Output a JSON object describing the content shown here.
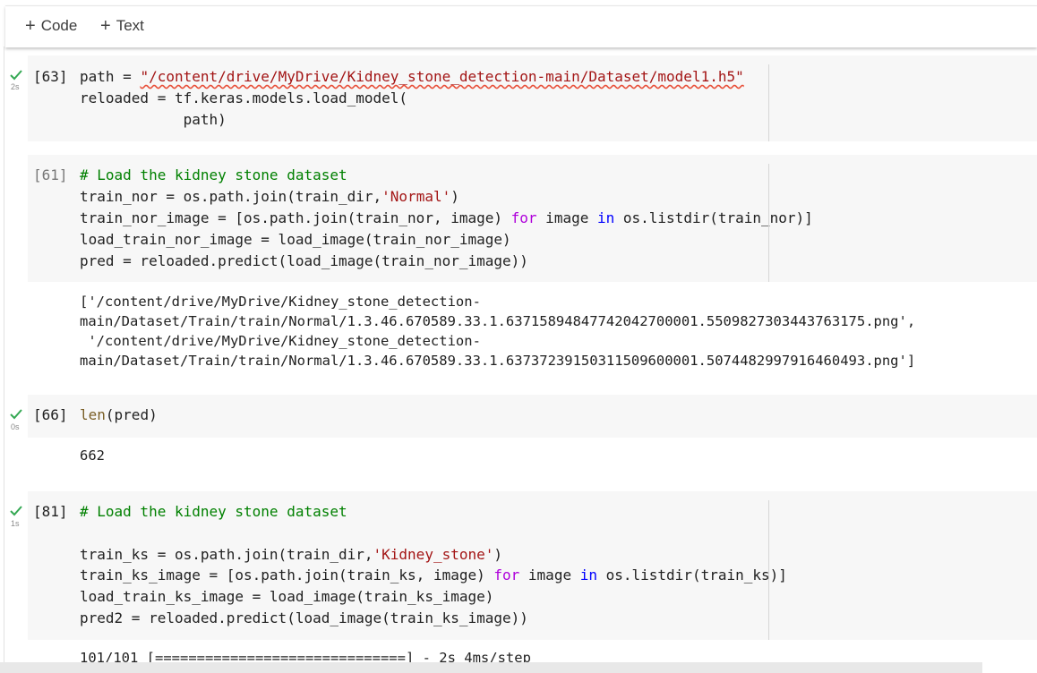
{
  "toolbar": {
    "add_code": "Code",
    "add_text": "Text"
  },
  "cells": {
    "c63": {
      "count": "[63]",
      "duration": "2s",
      "l1_a": "path = ",
      "l1_str": "\"/content/drive/MyDrive/Kidney_stone_detection-main/Dataset/model1.h5\"",
      "l2": "reloaded = tf.keras.models.load_model(",
      "l3": "            path)"
    },
    "c61": {
      "count": "[61]",
      "l1": "# Load the kidney stone dataset",
      "l2_a": "train_nor = os.path.join(train_dir,",
      "l2_str": "'Normal'",
      "l2_b": ")",
      "l3_a": "train_nor_image = [os.path.join(train_nor, image) ",
      "l3_for": "for",
      "l3_b": " image ",
      "l3_in": "in",
      "l3_c": " os.listdir(train_nor)]",
      "l4": "load_train_nor_image = load_image(train_nor_image)",
      "l5": "pred = reloaded.predict(load_image(train_nor_image))",
      "output": [
        "['/content/drive/MyDrive/Kidney_stone_detection-",
        "main/Dataset/Train/train/Normal/1.3.46.670589.33.1.63715894847742042700001.5509827303443763175.png',",
        " '/content/drive/MyDrive/Kidney_stone_detection-",
        "main/Dataset/Train/train/Normal/1.3.46.670589.33.1.63737239150311509600001.5074482997916460493.png']"
      ]
    },
    "c66": {
      "count": "[66]",
      "duration": "0s",
      "l1_fn": "len",
      "l1_b": "(pred)",
      "output": "662"
    },
    "c81": {
      "count": "[81]",
      "duration": "1s",
      "l1": "# Load the kidney stone dataset",
      "l3_a": "train_ks = os.path.join(train_dir,",
      "l3_str": "'Kidney_stone'",
      "l3_b": ")",
      "l4_a": "train_ks_image = [os.path.join(train_ks, image) ",
      "l4_for": "for",
      "l4_b": " image ",
      "l4_in": "in",
      "l4_c": " os.listdir(train_ks)]",
      "l5": "load_train_ks_image = load_image(train_ks_image)",
      "l6": "pred2 = reloaded.predict(load_image(train_ks_image))",
      "output": "101/101 [==============================] - 2s 4ms/step"
    }
  },
  "colors": {
    "check": "#34a853",
    "string": "#a31515",
    "keyword": "#af00db",
    "comment": "#008000"
  }
}
